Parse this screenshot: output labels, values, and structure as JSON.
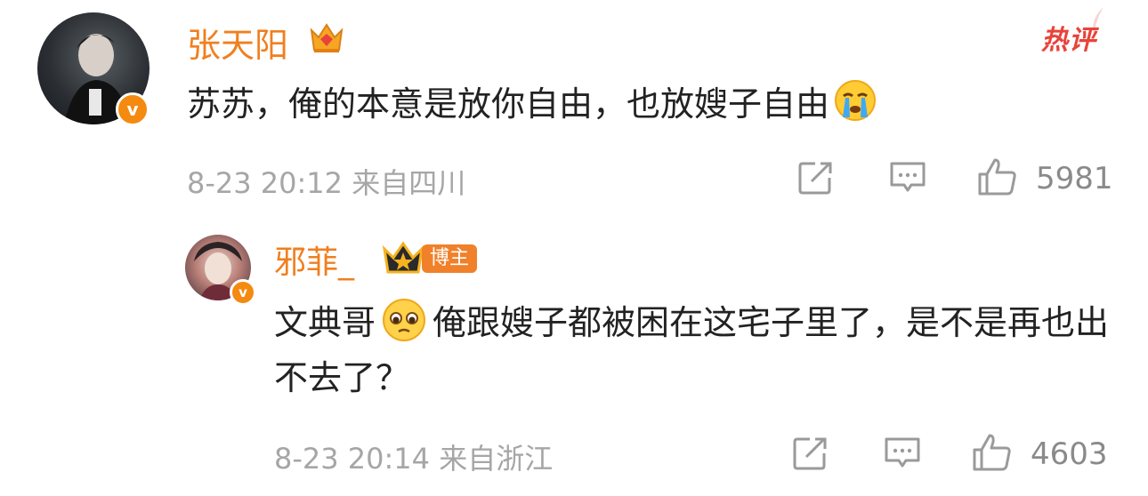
{
  "colors": {
    "username": "#f07f1e",
    "content": "#222222",
    "meta": "#a6a6a6",
    "hot": "#e8433a",
    "verified": "#f48a10"
  },
  "comment": {
    "username": "张天阳",
    "level_icon": "diamond-crown-icon",
    "text": "苏苏，俺的本意是放你自由，也放嫂子自由",
    "emoji": "crying-face-icon",
    "time": "8-23 20:12",
    "location": "来自四川",
    "likes": "5981",
    "tag": "热评"
  },
  "reply": {
    "username": "邪菲_",
    "level_icon": "gold-crown-icon",
    "badge": "博主",
    "text_prefix": "文典哥",
    "emoji": "pleading-face-icon",
    "text_body": "俺跟嫂子都被困在这宅子里了，是不是再也出不去了？",
    "time": "8-23 20:14",
    "location": "来自浙江",
    "likes": "4603"
  }
}
